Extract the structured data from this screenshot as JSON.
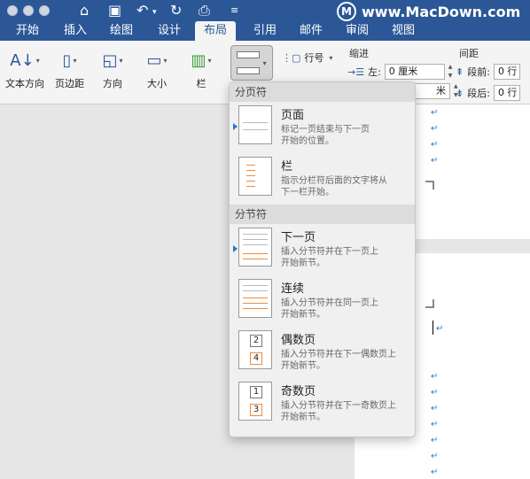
{
  "watermark": {
    "text": "www.MacDown.com",
    "logo_letter": "M"
  },
  "quick_access": {
    "icons": [
      "home-icon",
      "save-icon",
      "undo-icon",
      "redo-icon",
      "print-icon",
      "customize-icon"
    ]
  },
  "tabs": [
    "开始",
    "插入",
    "绘图",
    "设计",
    "布局",
    "引用",
    "邮件",
    "审阅",
    "视图"
  ],
  "active_tab": "布局",
  "ribbon": {
    "text_direction": "文本方向",
    "margins": "页边距",
    "orientation": "方向",
    "size": "大小",
    "columns": "栏",
    "line_numbers": "行号",
    "indent_group": "缩进",
    "indent_left_label": "左:",
    "indent_left_value": "0 厘米",
    "indent_right_value": "米",
    "spacing_group": "间距",
    "spacing_before_label": "段前:",
    "spacing_before_value": "0 行",
    "spacing_after_label": "段后:",
    "spacing_after_value": "0 行"
  },
  "menu": {
    "page_breaks_header": "分页符",
    "section_breaks_header": "分节符",
    "items": [
      {
        "title": "页面",
        "desc1": "标记一页结束与下一页",
        "desc2": "开始的位置。"
      },
      {
        "title": "栏",
        "desc1": "指示分栏符后面的文字将从",
        "desc2": "下一栏开始。"
      },
      {
        "title": "下一页",
        "desc1": "插入分节符并在下一页上",
        "desc2": "开始新节。"
      },
      {
        "title": "连续",
        "desc1": "插入分节符并在同一页上",
        "desc2": "开始新节。"
      },
      {
        "title": "偶数页",
        "desc1": "插入分节符并在下一偶数页上",
        "desc2": "开始新节。",
        "icon_nums": [
          "2",
          "4"
        ]
      },
      {
        "title": "奇数页",
        "desc1": "插入分节符并在下一奇数页上",
        "desc2": "开始新节。",
        "icon_nums": [
          "1",
          "3"
        ]
      }
    ]
  },
  "colors": {
    "title_bar": "#2b5797",
    "ribbon": "#f4f4f4",
    "menu": "#f0f0f0",
    "accent_orange": "#f08a3c",
    "paragraph_mark": "#2b77c7"
  }
}
